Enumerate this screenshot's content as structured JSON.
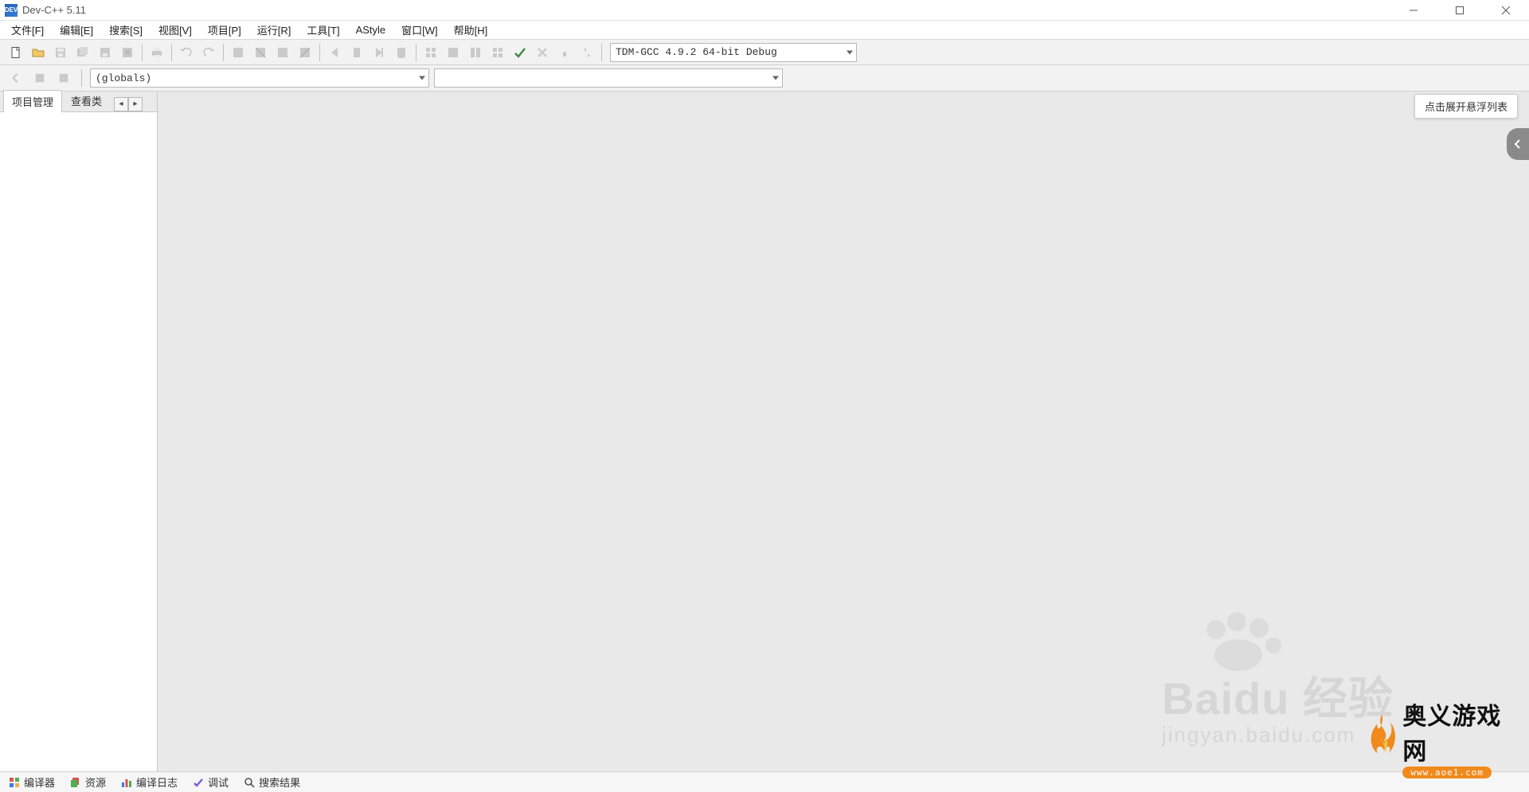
{
  "title": "Dev-C++ 5.11",
  "menu": {
    "file": "文件[F]",
    "edit": "编辑[E]",
    "search": "搜索[S]",
    "view": "视图[V]",
    "project": "项目[P]",
    "run": "运行[R]",
    "tools": "工具[T]",
    "astyle": "AStyle",
    "window": "窗口[W]",
    "help": "帮助[H]"
  },
  "compiler_combo": "TDM-GCC 4.9.2 64-bit Debug",
  "scope_combo": "(globals)",
  "members_combo": "",
  "left_panel": {
    "tab_project": "项目管理",
    "tab_classview": "查看类"
  },
  "float_hint": "点击展开悬浮列表",
  "status_tabs": {
    "compiler": "编译器",
    "resources": "资源",
    "build_log": "编译日志",
    "debug": "调试",
    "search_results": "搜索结果"
  },
  "watermark": {
    "brand_en": "Baidu",
    "brand_cn": "经验",
    "url": "jingyan.baidu.com"
  },
  "site_logo": {
    "cn": "奥义游戏网",
    "en": "www.aoe1.com"
  }
}
